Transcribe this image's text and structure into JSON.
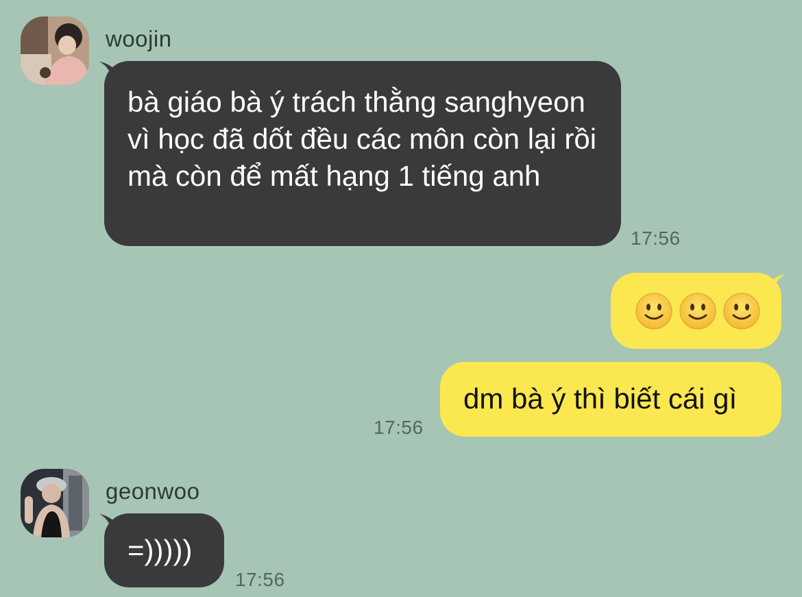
{
  "chat": {
    "messages": [
      {
        "sender": "woojin",
        "avatar_icon": "woojin-profile-photo",
        "text": "bà giáo bà ý trách thằng sanghyeon vì học đã dốt đều các môn còn lại rồi mà còn để mất hạng 1 tiếng anh",
        "time": "17:56"
      },
      {
        "sender": "me",
        "emojis": [
          "slightly-smiling-face-emoji",
          "slightly-smiling-face-emoji",
          "slightly-smiling-face-emoji"
        ]
      },
      {
        "sender": "me",
        "text": "dm bà ý thì biết cái gì",
        "time": "17:56"
      },
      {
        "sender": "geonwoo",
        "avatar_icon": "geonwoo-profile-photo",
        "text": "=)))))",
        "time": "17:56"
      }
    ]
  },
  "colors": {
    "background": "#a6c5b5",
    "incoming_bubble": "#3a3a3c",
    "outgoing_bubble": "#fbe74f"
  }
}
